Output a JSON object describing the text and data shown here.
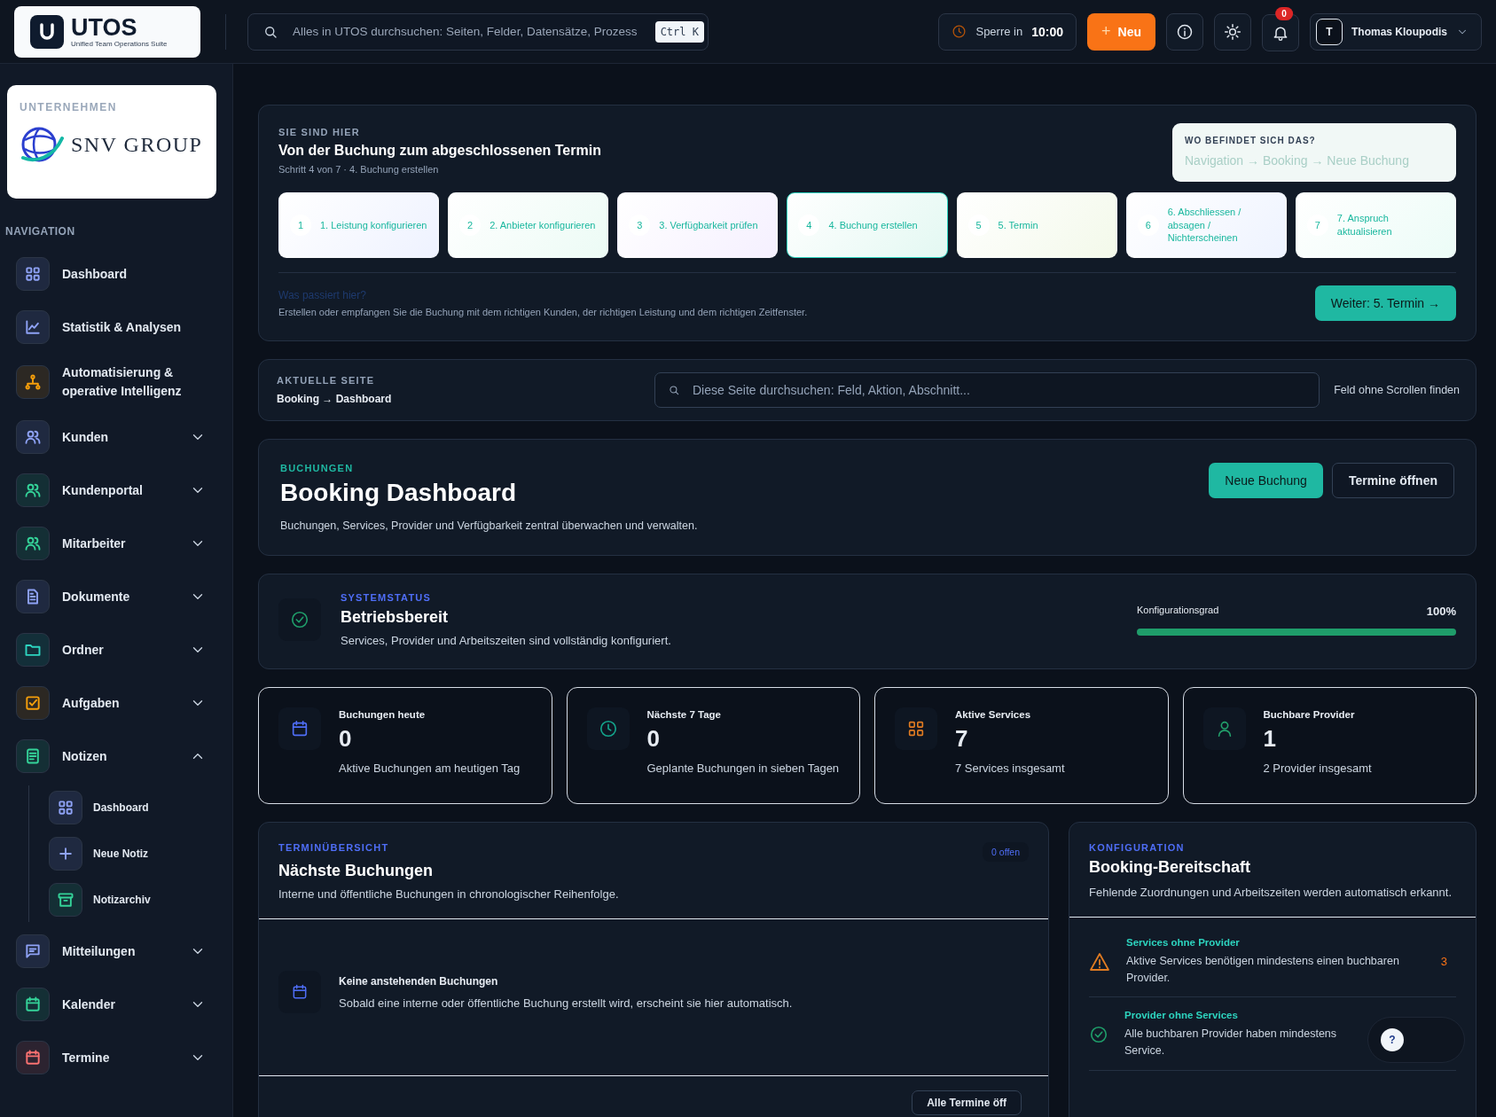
{
  "topbar": {
    "logo": {
      "name": "UTOS",
      "tagline": "Unified Team Operations Suite"
    },
    "search": {
      "placeholder": "Alles in UTOS durchsuchen: Seiten, Felder, Datensätze, Prozess",
      "shortcut": "Ctrl K"
    },
    "lock": {
      "label": "Sperre in",
      "time": "10:00"
    },
    "new_button": {
      "icon": "+",
      "label": "Neu"
    },
    "notifications": {
      "count": "0"
    },
    "user": {
      "initial": "T",
      "name": "Thomas Kloupodis"
    }
  },
  "sidebar": {
    "company": {
      "label": "UNTERNEHMEN",
      "name": "SNV GROUP"
    },
    "nav_title": "NAVIGATION",
    "items": [
      {
        "label": "Dashboard",
        "color": "#8ea2f5"
      },
      {
        "label": "Statistik & Analysen",
        "color": "#8ea2f5"
      },
      {
        "label": "Automatisierung & operative Intelligenz",
        "color": "#f59e0b"
      },
      {
        "label": "Kunden",
        "color": "#8ea2f5",
        "expanded": false
      },
      {
        "label": "Kundenportal",
        "color": "#34d399",
        "expanded": false
      },
      {
        "label": "Mitarbeiter",
        "color": "#34d399",
        "expanded": false
      },
      {
        "label": "Dokumente",
        "color": "#8ea2f5",
        "expanded": false
      },
      {
        "label": "Ordner",
        "color": "#2dd4bf",
        "expanded": false
      },
      {
        "label": "Aufgaben",
        "color": "#f59e0b",
        "expanded": false
      },
      {
        "label": "Notizen",
        "color": "#34d399",
        "expanded": true,
        "children": [
          {
            "label": "Dashboard",
            "color": "#8ea2f5"
          },
          {
            "label": "Neue Notiz",
            "color": "#8ea2f5"
          },
          {
            "label": "Notizarchiv",
            "color": "#34d399"
          }
        ]
      },
      {
        "label": "Mitteilungen",
        "color": "#8ea2f5",
        "expanded": false
      },
      {
        "label": "Kalender",
        "color": "#34d399",
        "expanded": false
      },
      {
        "label": "Termine",
        "color": "#f87171",
        "expanded": false
      }
    ]
  },
  "wizard": {
    "eyebrow": "SIE SIND HIER",
    "title": "Von der Buchung zum abgeschlossenen Termin",
    "subtitle": "Schritt 4 von 7 · 4. Buchung erstellen",
    "location": {
      "title": "WO BEFINDET SICH DAS?",
      "path": "Navigation → Booking → Neue Buchung"
    },
    "steps": [
      {
        "number": "1",
        "label": "1. Leistung konfigurieren",
        "selected": false
      },
      {
        "number": "2",
        "label": "2. Anbieter konfigurieren",
        "selected": false
      },
      {
        "number": "3",
        "label": "3. Verfügbarkeit prüfen",
        "selected": false
      },
      {
        "number": "4",
        "label": "4. Buchung erstellen",
        "selected": true
      },
      {
        "number": "5",
        "label": "5. Termin",
        "selected": false
      },
      {
        "number": "6",
        "label": "6. Abschliessen / absagen / Nichterscheinen",
        "selected": false
      },
      {
        "number": "7",
        "label": "7. Anspruch aktualisieren",
        "selected": false
      }
    ],
    "help_link": "Was passiert hier?",
    "description": "Erstellen oder empfangen Sie die Buchung mit dem richtigen Kunden, der richtigen Leistung und dem richtigen Zeitfenster.",
    "next_button": "Weiter: 5. Termin →"
  },
  "current_page": {
    "eyebrow": "AKTUELLE SEITE",
    "breadcrumb": "Booking → Dashboard",
    "search_placeholder": "Diese Seite durchsuchen: Feld, Aktion, Abschnitt...",
    "hint": "Feld ohne Scrollen finden"
  },
  "header": {
    "eyebrow": "BUCHUNGEN",
    "title": "Booking Dashboard",
    "subtitle": "Buchungen, Services, Provider und Verfügbarkeit zentral überwachen und verwalten.",
    "buttons": [
      {
        "label": "Neue Buchung",
        "kind": "primary"
      },
      {
        "label": "Termine öffnen",
        "kind": "secondary"
      }
    ]
  },
  "system_status": {
    "eyebrow": "SYSTEMSTATUS",
    "title": "Betriebsbereit",
    "description": "Services, Provider und Arbeitszeiten sind vollständig konfiguriert.",
    "meter": {
      "label": "Konfigurationsgrad",
      "reading": "100%",
      "level": 1
    }
  },
  "stats": [
    {
      "title": "Buchungen heute",
      "value": "0",
      "caption": "Aktive Buchungen am heutigen Tag",
      "color": "#4f6ef7"
    },
    {
      "title": "Nächste 7 Tage",
      "value": "0",
      "caption": "Geplante Buchungen in sieben Tagen",
      "color": "#14a38b"
    },
    {
      "title": "Aktive Services",
      "value": "7",
      "caption": "7 Services insgesamt",
      "color": "#e07b22"
    },
    {
      "title": "Buchbare Provider",
      "value": "1",
      "caption": "2 Provider insgesamt",
      "color": "#22a06b"
    }
  ],
  "upcoming": {
    "eyebrow": "TERMINÜBERSICHT",
    "title": "Nächste Buchungen",
    "badge": "0 offen",
    "subtitle": "Interne und öffentliche Buchungen in chronologischer Reihenfolge.",
    "empty_title": "Keine anstehenden Buchungen",
    "empty_text": "Sobald eine interne oder öffentliche Buchung erstellt wird, erscheint sie hier automatisch.",
    "footer_button": "Alle Termine öff"
  },
  "readiness": {
    "eyebrow": "KONFIGURATION",
    "title": "Booking-Bereitschaft",
    "subtitle": "Fehlende Zuordnungen und Arbeitszeiten werden automatisch erkannt.",
    "checks": [
      {
        "kind": "warning",
        "title": "Services ohne Provider",
        "lines": [
          "Aktive Services benötigen mindestens einen buchbaren",
          "Provider."
        ],
        "count": "3"
      },
      {
        "kind": "ok",
        "title": "Provider ohne Services",
        "lines": [
          "Alle buchbaren Provider haben mindestens",
          "Service."
        ]
      }
    ]
  },
  "help_bubble": {
    "label": "?"
  }
}
